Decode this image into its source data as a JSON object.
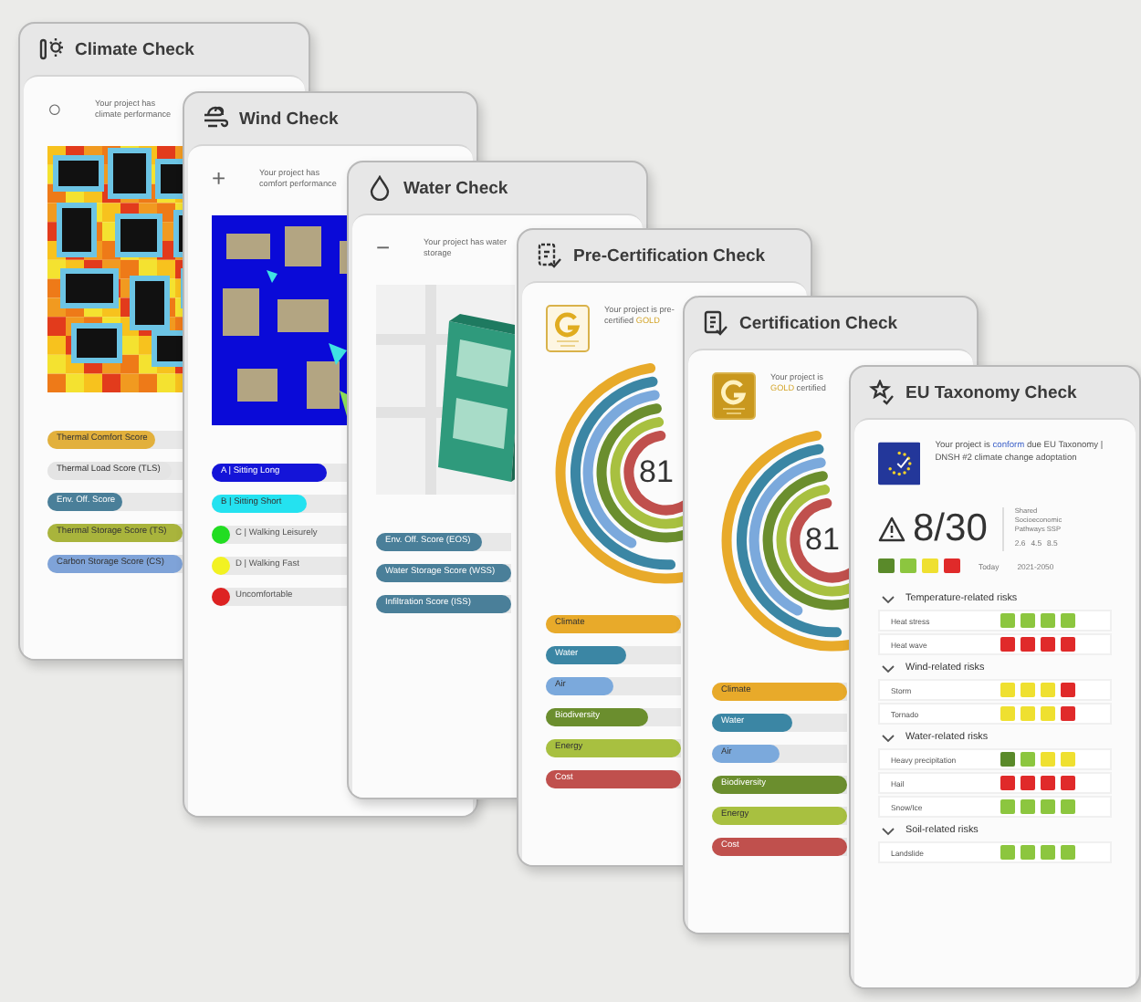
{
  "cards": [
    {
      "kind": "climate",
      "title": "Climate Check",
      "marker": "○",
      "description": [
        {
          "text": "Your project has climate performance",
          "highlighted": false
        }
      ],
      "bars": [
        {
          "label": "Thermal Comfort Score",
          "kind": "bar",
          "level": 0.8,
          "color": "#e2b03c"
        },
        {
          "label": "Thermal Load Score (TLS)",
          "kind": "bar",
          "level": 0.92,
          "color": "#e4e4e4"
        },
        {
          "label": "Env. Off. Score",
          "kind": "bar",
          "level": 0.55,
          "color": "#4a7f99"
        },
        {
          "label": "Thermal Storage Score (TS)",
          "kind": "bar",
          "level": 1,
          "color": "#a9b43c"
        },
        {
          "label": "Carbon Storage Score (CS)",
          "kind": "bar",
          "level": 1,
          "color": "#7fa3d8"
        }
      ]
    },
    {
      "kind": "wind",
      "title": "Wind Check",
      "marker": "+",
      "description": [
        {
          "text": "Your project has comfort performance",
          "highlighted": false
        }
      ],
      "bars": [
        {
          "label": "A | Sitting Long",
          "kind": "bar",
          "level": 0.85,
          "color": "#1414d8"
        },
        {
          "label": "B | Sitting Short",
          "kind": "bar",
          "level": 0.7,
          "color": "#24e2f0"
        },
        {
          "label": "C | Walking Leisurely",
          "kind": "dot",
          "color": "#22dd22"
        },
        {
          "label": "D | Walking Fast",
          "kind": "dot",
          "color": "#f2f222"
        },
        {
          "label": "Uncomfortable",
          "kind": "dot",
          "color": "#dd2222"
        }
      ]
    },
    {
      "kind": "water",
      "title": "Water Check",
      "marker": "−",
      "description": [
        {
          "text": "Your project has water storage",
          "highlighted": false
        }
      ],
      "bars": [
        {
          "label": "Env. Off. Score (EOS)",
          "kind": "bar",
          "level": 0.78,
          "color": "#4a7f99"
        },
        {
          "label": "Water Storage Score (WSS)",
          "kind": "bar",
          "level": 1,
          "color": "#4a7f99"
        },
        {
          "label": "Infiltration Score (ISS)",
          "kind": "bar",
          "level": 1,
          "color": "#4a7f99"
        }
      ]
    },
    {
      "kind": "precert",
      "title": "Pre-Certification Check",
      "description": [
        {
          "text": "Your project is pre-certified ",
          "highlighted": false
        },
        {
          "text": "GOLD",
          "highlighted": true
        }
      ],
      "score": "81",
      "bars": [
        {
          "label": "Climate",
          "kind": "bar",
          "level": 1,
          "color": "#e8aa2a"
        },
        {
          "label": "Water",
          "kind": "bar",
          "level": 0.6,
          "color": "#3b86a4"
        },
        {
          "label": "Air",
          "kind": "bar",
          "level": 0.5,
          "color": "#7ba9dc"
        },
        {
          "label": "Biodiversity",
          "kind": "bar",
          "level": 0.76,
          "color": "#6b8e2e"
        },
        {
          "label": "Energy",
          "kind": "bar",
          "level": 1,
          "color": "#a8c040"
        },
        {
          "label": "Cost",
          "kind": "bar",
          "level": 1,
          "color": "#c0504d"
        }
      ]
    },
    {
      "kind": "cert",
      "title": "Certification Check",
      "description": [
        {
          "text": "Your project is ",
          "highlighted": false
        },
        {
          "text": "GOLD",
          "highlighted": true
        },
        {
          "text": " certified",
          "highlighted": false
        }
      ],
      "score": "81",
      "bars": [
        {
          "label": "Climate",
          "kind": "bar",
          "level": 1,
          "color": "#e8aa2a"
        },
        {
          "label": "Water",
          "kind": "bar",
          "level": 0.6,
          "color": "#3b86a4"
        },
        {
          "label": "Air",
          "kind": "bar",
          "level": 0.5,
          "color": "#7ba9dc"
        },
        {
          "label": "Biodiversity",
          "kind": "bar",
          "level": 1,
          "color": "#6b8e2e"
        },
        {
          "label": "Energy",
          "kind": "bar",
          "level": 1,
          "color": "#a8c040"
        },
        {
          "label": "Cost",
          "kind": "bar",
          "level": 1,
          "color": "#c0504d"
        }
      ]
    },
    {
      "kind": "eu",
      "title": "EU Taxonomy Check",
      "description": [
        {
          "text": "Your project is ",
          "highlighted": false
        },
        {
          "text": "conform",
          "highlighted": true
        },
        {
          "text": " due EU Taxonomy | DNSH #2 climate change adoptation",
          "highlighted": false
        }
      ],
      "score": "8/30",
      "ssp": "Shared Socioeconomic Pathways SSP",
      "ssp_values": [
        "2.6",
        "4.5",
        "8.5"
      ],
      "period_label": "Today",
      "period": "2021-2050",
      "legend": [
        {
          "color": "#5a8a2a"
        },
        {
          "color": "#8cc63f"
        },
        {
          "color": "#efe030"
        },
        {
          "color": "#e02a2a"
        }
      ],
      "sections": [
        {
          "title": "Temperature-related risks",
          "expanded": true,
          "rows": [
            {
              "label": "Heat stress",
              "cells": [
                {
                  "color": "#8cc63f"
                },
                {
                  "color": "#8cc63f"
                },
                {
                  "color": "#8cc63f"
                },
                {
                  "color": "#8cc63f"
                }
              ]
            },
            {
              "label": "Heat wave",
              "cells": [
                {
                  "color": "#e02a2a"
                },
                {
                  "color": "#e02a2a"
                },
                {
                  "color": "#e02a2a"
                },
                {
                  "color": "#e02a2a"
                }
              ]
            }
          ]
        },
        {
          "title": "Wind-related risks",
          "expanded": true,
          "rows": [
            {
              "label": "Storm",
              "cells": [
                {
                  "color": "#efe030"
                },
                {
                  "color": "#efe030"
                },
                {
                  "color": "#efe030"
                },
                {
                  "color": "#e02a2a"
                }
              ]
            },
            {
              "label": "Tornado",
              "cells": [
                {
                  "color": "#efe030"
                },
                {
                  "color": "#efe030"
                },
                {
                  "color": "#efe030"
                },
                {
                  "color": "#e02a2a"
                }
              ]
            }
          ]
        },
        {
          "title": "Water-related risks",
          "expanded": true,
          "rows": [
            {
              "label": "Heavy precipitation",
              "cells": [
                {
                  "color": "#5a8a2a"
                },
                {
                  "color": "#8cc63f"
                },
                {
                  "color": "#efe030"
                },
                {
                  "color": "#efe030"
                }
              ]
            },
            {
              "label": "Hail",
              "cells": [
                {
                  "color": "#e02a2a"
                },
                {
                  "color": "#e02a2a"
                },
                {
                  "color": "#e02a2a"
                },
                {
                  "color": "#e02a2a"
                }
              ]
            },
            {
              "label": "Snow/Ice",
              "cells": [
                {
                  "color": "#8cc63f"
                },
                {
                  "color": "#8cc63f"
                },
                {
                  "color": "#8cc63f"
                },
                {
                  "color": "#8cc63f"
                }
              ]
            }
          ]
        },
        {
          "title": "Soil-related risks",
          "expanded": true,
          "rows": [
            {
              "label": "Landslide",
              "cells": [
                {
                  "color": "#8cc63f"
                },
                {
                  "color": "#8cc63f"
                },
                {
                  "color": "#8cc63f"
                },
                {
                  "color": "#8cc63f"
                }
              ]
            }
          ]
        }
      ]
    }
  ]
}
